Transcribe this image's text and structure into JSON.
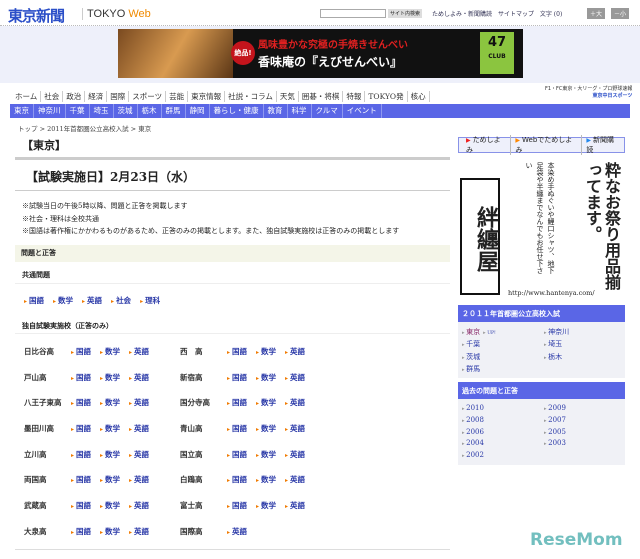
{
  "header": {
    "logo": "東京新聞",
    "logo_sub_a": "TOKYO ",
    "logo_sub_b": "Web",
    "search_placeholder": "",
    "search_button": "サイト内検索",
    "links": [
      "ためしよみ・新聞購読",
      "サイトマップ",
      "文字 (0)"
    ],
    "font_larger": "＋大",
    "font_smaller": "－小"
  },
  "ad": {
    "badge": "絶品!",
    "line1": "風味豊かな究極の手焼きせんべい",
    "line2": "香味庵の『えびせんべい』",
    "club": "47",
    "club_sub": "CLUB"
  },
  "nav_main": [
    "ホーム",
    "社会",
    "政治",
    "経済",
    "国際",
    "スポーツ",
    "芸能",
    "東京情報",
    "社説・コラム",
    "天気",
    "囲碁・将棋",
    "特報",
    "TOKYO発",
    "核心"
  ],
  "chunichi": {
    "line1": "F1・FC東京・大リーグ・プロ野球速報",
    "line2": "東京中日スポーツ"
  },
  "nav_region": [
    "東京",
    "神奈川",
    "千葉",
    "埼玉",
    "茨城",
    "栃木",
    "群馬",
    "静岡",
    "暮らし・健康",
    "教育",
    "科学",
    "クルマ",
    "イベント"
  ],
  "breadcrumb": "トップ > 2011年首都圏公立高校入試 > 東京",
  "main": {
    "title": "【東京】",
    "date_heading": "【試験実施日】2月23日（水）",
    "notes": [
      "※試験当日の午後5時以降、問題と正答を掲載します",
      "※社会・理科は全校共通",
      "※国語は著作権にかかわるものがあるため、正答のみの掲載とします。また、独自試験実施校は正答のみの掲載とします"
    ],
    "section": "問題と正答",
    "common_heading": "共通問題",
    "common_subjects": [
      "国語",
      "数学",
      "英語",
      "社会",
      "理科"
    ],
    "independent_heading": "独自試験実施校（正答のみ）",
    "schools": [
      [
        {
          "name": "日比谷高",
          "subjects": [
            "国語",
            "数学",
            "英語"
          ]
        },
        {
          "name": "西　高",
          "subjects": [
            "国語",
            "数学",
            "英語"
          ]
        }
      ],
      [
        {
          "name": "戸山高",
          "subjects": [
            "国語",
            "数学",
            "英語"
          ]
        },
        {
          "name": "新宿高",
          "subjects": [
            "国語",
            "数学",
            "英語"
          ]
        }
      ],
      [
        {
          "name": "八王子東高",
          "subjects": [
            "国語",
            "数学",
            "英語"
          ]
        },
        {
          "name": "国分寺高",
          "subjects": [
            "国語",
            "数学",
            "英語"
          ]
        }
      ],
      [
        {
          "name": "墨田川高",
          "subjects": [
            "国語",
            "数学",
            "英語"
          ]
        },
        {
          "name": "青山高",
          "subjects": [
            "国語",
            "数学",
            "英語"
          ]
        }
      ],
      [
        {
          "name": "立川高",
          "subjects": [
            "国語",
            "数学",
            "英語"
          ]
        },
        {
          "name": "国立高",
          "subjects": [
            "国語",
            "数学",
            "英語"
          ]
        }
      ],
      [
        {
          "name": "両国高",
          "subjects": [
            "国語",
            "数学",
            "英語"
          ]
        },
        {
          "name": "白鴎高",
          "subjects": [
            "国語",
            "数学",
            "英語"
          ]
        }
      ],
      [
        {
          "name": "武蔵高",
          "subjects": [
            "国語",
            "数学",
            "英語"
          ]
        },
        {
          "name": "富士高",
          "subjects": [
            "国語",
            "数学",
            "英語"
          ]
        }
      ],
      [
        {
          "name": "大泉高",
          "subjects": [
            "国語",
            "数学",
            "英語"
          ]
        },
        {
          "name": "国際高",
          "subjects": [
            "英語"
          ]
        }
      ]
    ]
  },
  "sidebar": {
    "buttons": [
      "ためしよみ",
      "Webでためしよみ",
      "新聞購読"
    ],
    "ad": {
      "logo": "絆纏屋",
      "headline": "粋なお祭り用品揃ってます。",
      "copy": "本染め手ぬぐいや鯉口シャツ、地下足袋や半纏までなんでもお任せ下さい",
      "url": "http://www.hantenya.com/"
    },
    "exam_heading": "２０１１年首都圏公立高校入試",
    "exam_prefectures": [
      "東京",
      "神奈川",
      "千葉",
      "埼玉",
      "茨城",
      "栃木",
      "群馬"
    ],
    "up_badge": "UP!",
    "past_heading": "過去の問題と正答",
    "past_years": [
      "2010",
      "2009",
      "2008",
      "2007",
      "2006",
      "2005",
      "2004",
      "2003",
      "2002"
    ]
  },
  "watermark": "ReseMom"
}
